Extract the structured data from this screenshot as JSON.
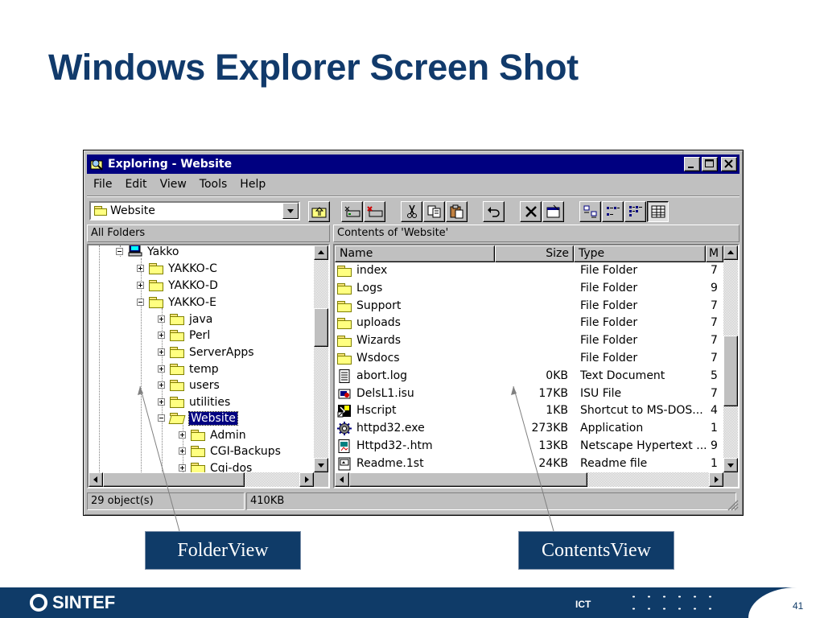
{
  "slide": {
    "title": "Windows Explorer Screen Shot",
    "page_number": "41",
    "footer_brand": "SINTEF",
    "footer_unit": "ICT"
  },
  "window": {
    "title": "Exploring - Website",
    "menu": [
      "File",
      "Edit",
      "View",
      "Tools",
      "Help"
    ],
    "address_value": "Website",
    "all_folders_label": "All Folders",
    "contents_label": "Contents of 'Website'",
    "toolbar_icons": [
      "up-folder-icon",
      "map-drive-icon",
      "disconnect-drive-icon",
      "cut-icon",
      "copy-icon",
      "paste-icon",
      "undo-icon",
      "delete-icon",
      "properties-icon",
      "large-icons-icon",
      "small-icons-icon",
      "list-icon",
      "details-icon"
    ]
  },
  "tree": {
    "items": [
      {
        "label": "Yakko",
        "icon": "computer-icon",
        "expander": "minus"
      },
      {
        "label": "YAKKO-C",
        "icon": "folder-icon",
        "expander": "plus"
      },
      {
        "label": "YAKKO-D",
        "icon": "folder-icon",
        "expander": "plus"
      },
      {
        "label": "YAKKO-E",
        "icon": "folder-icon",
        "expander": "minus"
      },
      {
        "label": "java",
        "icon": "folder-icon",
        "expander": "plus"
      },
      {
        "label": "Perl",
        "icon": "folder-icon",
        "expander": "plus"
      },
      {
        "label": "ServerApps",
        "icon": "folder-icon",
        "expander": "plus"
      },
      {
        "label": "temp",
        "icon": "folder-icon",
        "expander": "plus"
      },
      {
        "label": "users",
        "icon": "folder-icon",
        "expander": "plus"
      },
      {
        "label": "utilities",
        "icon": "folder-icon",
        "expander": "plus"
      },
      {
        "label": "Website",
        "icon": "open-folder-icon",
        "expander": "minus",
        "selected": true
      },
      {
        "label": "Admin",
        "icon": "folder-icon",
        "expander": "plus"
      },
      {
        "label": "CGI-Backups",
        "icon": "folder-icon",
        "expander": "plus"
      },
      {
        "label": "Cgi-dos",
        "icon": "folder-icon",
        "expander": "plus"
      }
    ]
  },
  "contents": {
    "columns": [
      "Name",
      "Size",
      "Type",
      "M"
    ],
    "rows": [
      {
        "name": "index",
        "size": "",
        "type": "File Folder",
        "modified": "7",
        "icon": "folder-icon"
      },
      {
        "name": "Logs",
        "size": "",
        "type": "File Folder",
        "modified": "9",
        "icon": "folder-icon"
      },
      {
        "name": "Support",
        "size": "",
        "type": "File Folder",
        "modified": "7",
        "icon": "folder-icon"
      },
      {
        "name": "uploads",
        "size": "",
        "type": "File Folder",
        "modified": "7",
        "icon": "folder-icon"
      },
      {
        "name": "Wizards",
        "size": "",
        "type": "File Folder",
        "modified": "7",
        "icon": "folder-icon"
      },
      {
        "name": "Wsdocs",
        "size": "",
        "type": "File Folder",
        "modified": "7",
        "icon": "folder-icon"
      },
      {
        "name": "abort.log",
        "size": "0KB",
        "type": "Text Document",
        "modified": "5",
        "icon": "text-document-icon"
      },
      {
        "name": "DelsL1.isu",
        "size": "17KB",
        "type": "ISU File",
        "modified": "7",
        "icon": "isu-file-icon"
      },
      {
        "name": "Hscript",
        "size": "1KB",
        "type": "Shortcut to MS-DOS...",
        "modified": "4",
        "icon": "msdos-shortcut-icon"
      },
      {
        "name": "httpd32.exe",
        "size": "273KB",
        "type": "Application",
        "modified": "1",
        "icon": "application-gear-icon"
      },
      {
        "name": "Httpd32-.htm",
        "size": "13KB",
        "type": "Netscape Hypertext ...",
        "modified": "9",
        "icon": "html-document-icon"
      },
      {
        "name": "Readme.1st",
        "size": "24KB",
        "type": "Readme file",
        "modified": "1",
        "icon": "readme-file-icon"
      }
    ]
  },
  "status": {
    "objects": "29 object(s)",
    "size": "410KB"
  },
  "callouts": {
    "folder_view": "FolderView",
    "contents_view": "ContentsView"
  },
  "colors": {
    "title_blue": "#113a6b",
    "titlebar": "#000080",
    "window_face": "#c0c0c0",
    "callout_bg": "#0f3b68"
  }
}
